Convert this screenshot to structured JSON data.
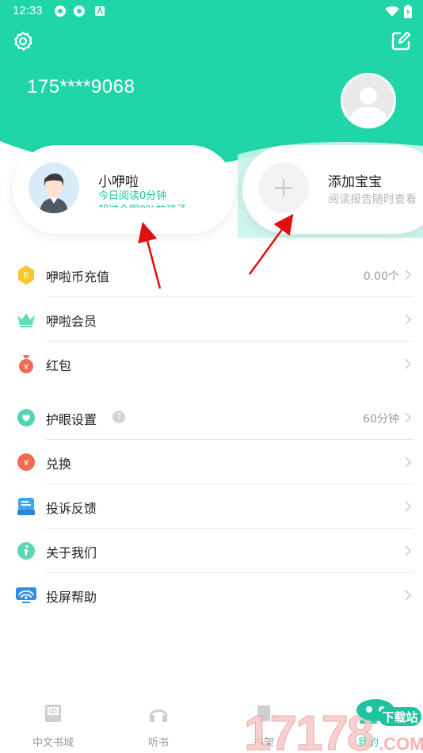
{
  "colors": {
    "brand": "#20d5a8",
    "brand_light": "#c9f5ea",
    "accent_text": "#1ec5a0",
    "annotation_arrow": "#e01010"
  },
  "status_bar": {
    "time": "12:33",
    "icons": [
      "notification-icon",
      "notification-icon",
      "notification-a-icon",
      "wifi-icon",
      "battery-icon"
    ]
  },
  "header": {
    "phone": "175****9068",
    "left_icon": "settings-gear-icon",
    "right_icon": "edit-icon"
  },
  "child_card": {
    "name": "小咿啦",
    "line1": "今日阅读0分钟",
    "line2": "超过全国0%的孩子"
  },
  "add_card": {
    "title": "添加宝宝",
    "subtitle": "阅读报告随时查看"
  },
  "menu": {
    "items": [
      {
        "label": "咿啦币充值",
        "value": "0.00个",
        "icon": "coin-icon"
      },
      {
        "label": "咿啦会员",
        "value": "",
        "icon": "crown-icon"
      },
      {
        "label": "红包",
        "value": "",
        "icon": "red-envelope-icon"
      },
      {
        "label": "护眼设置",
        "value": "60分钟",
        "icon": "eye-care-icon",
        "help": "?"
      },
      {
        "label": "兑换",
        "value": "",
        "icon": "exchange-icon"
      },
      {
        "label": "投诉反馈",
        "value": "",
        "icon": "feedback-icon"
      },
      {
        "label": "关于我们",
        "value": "",
        "icon": "info-icon"
      },
      {
        "label": "投屏帮助",
        "value": "",
        "icon": "screencast-icon"
      }
    ]
  },
  "bottom_nav": {
    "items": [
      {
        "label": "中文书城",
        "icon": "bookstore-icon"
      },
      {
        "label": "听书",
        "icon": "headphones-icon"
      },
      {
        "label": "书架",
        "icon": "bookshelf-icon"
      },
      {
        "label": "我的",
        "icon": "profile-icon"
      }
    ]
  },
  "watermark": {
    "number": "17178",
    "text": "下载站",
    "domain": ".COM"
  }
}
